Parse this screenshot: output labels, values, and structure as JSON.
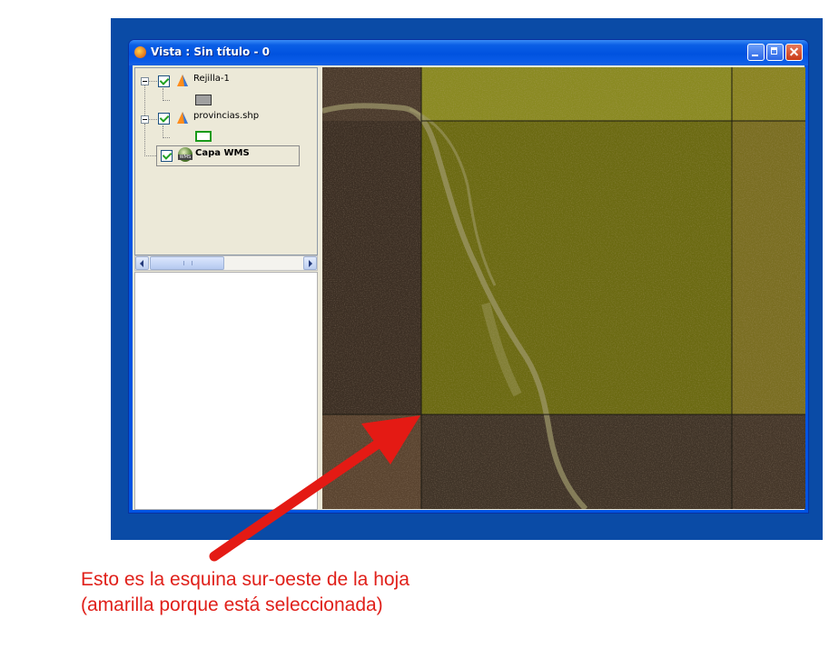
{
  "window": {
    "title": "Vista : Sin título - 0"
  },
  "toc": {
    "layers": [
      {
        "name": "Rejilla-1",
        "checked": true,
        "legend": "grey-fill"
      },
      {
        "name": "provincias.shp",
        "checked": true,
        "legend": "green-outline"
      },
      {
        "name": "Capa WMS",
        "checked": true,
        "selected": true
      }
    ]
  },
  "colors": {
    "selected_cell": "#6b6a12",
    "unselected_cell": "#3f3226",
    "annotation": "#e0201a"
  },
  "annotation": {
    "line1": "Esto es la esquina sur-oeste de la hoja",
    "line2": "(amarilla porque está seleccionada)"
  }
}
